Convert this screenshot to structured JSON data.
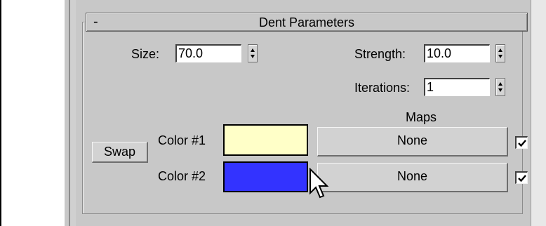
{
  "rollout": {
    "collapse_symbol": "-",
    "title": "Dent Parameters"
  },
  "params": {
    "size": {
      "label": "Size:",
      "value": "70.0"
    },
    "strength": {
      "label": "Strength:",
      "value": "10.0"
    },
    "iterations": {
      "label": "Iterations:",
      "value": "1"
    }
  },
  "maps_header": "Maps",
  "swap_label": "Swap",
  "colors": [
    {
      "label": "Color #1",
      "swatch": "#ffffc8",
      "map": "None",
      "enabled": true
    },
    {
      "label": "Color #2",
      "swatch": "#3333ff",
      "map": "None",
      "enabled": true
    }
  ],
  "icons": {
    "cursor": "mouse-pointer-icon",
    "spinner": "spinner-arrows-icon",
    "check": "checkmark-icon"
  }
}
